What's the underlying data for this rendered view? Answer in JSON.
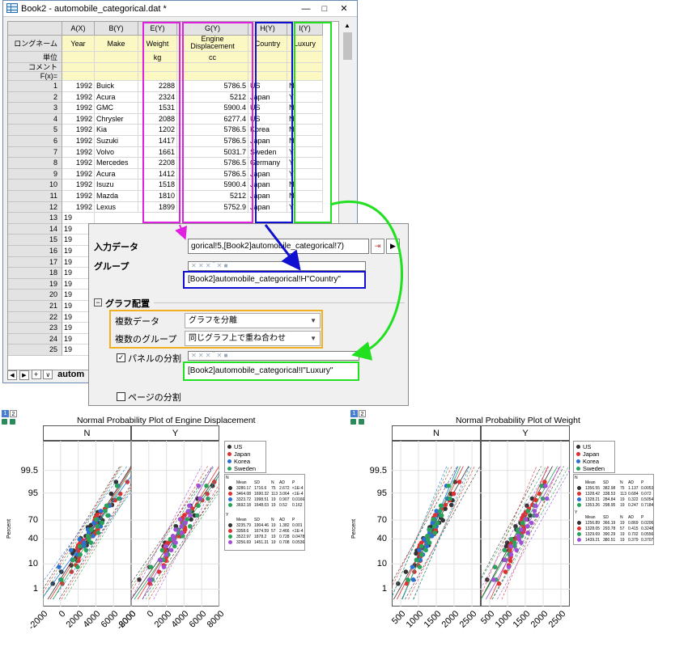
{
  "window": {
    "title": "Book2 - automobile_categorical.dat *",
    "min": "—",
    "max": "□",
    "close": "✕"
  },
  "sheet": {
    "columns": [
      {
        "header": "A(X)",
        "long": "Year",
        "unit": "",
        "w": 40
      },
      {
        "header": "B(Y)",
        "long": "Make",
        "unit": "",
        "w": 54
      },
      {
        "header": "E(Y)",
        "long": "Weight",
        "unit": "kg",
        "w": 48
      },
      {
        "header": "G(Y)",
        "long": "Engine Displacement",
        "unit": "cc",
        "w": 88
      },
      {
        "header": "H(Y)",
        "long": "Country",
        "unit": "",
        "w": 48
      },
      {
        "header": "I(Y)",
        "long": "Luxury",
        "unit": "",
        "w": 44
      }
    ],
    "meta_rows": [
      "ロングネーム",
      "単位",
      "コメント",
      "F(x)="
    ],
    "rows": [
      [
        "1992",
        "Buick",
        "2288",
        "5786.5",
        "US",
        "N"
      ],
      [
        "1992",
        "Acura",
        "2324",
        "5212",
        "Japan",
        "Y"
      ],
      [
        "1992",
        "GMC",
        "1531",
        "5900.4",
        "US",
        "N"
      ],
      [
        "1992",
        "Chrysler",
        "2088",
        "6277.4",
        "US",
        "N"
      ],
      [
        "1992",
        "Kia",
        "1202",
        "5786.5",
        "Korea",
        "N"
      ],
      [
        "1992",
        "Suzuki",
        "1417",
        "5786.5",
        "Japan",
        "N"
      ],
      [
        "1992",
        "Volvo",
        "1661",
        "5031.7",
        "Sweden",
        "Y"
      ],
      [
        "1992",
        "Mercedes",
        "2208",
        "5786.5",
        "Germany",
        "Y"
      ],
      [
        "1992",
        "Acura",
        "1412",
        "5786.5",
        "Japan",
        "Y"
      ],
      [
        "1992",
        "Isuzu",
        "1518",
        "5900.4",
        "Japan",
        "N"
      ],
      [
        "1992",
        "Mazda",
        "1810",
        "5212",
        "Japan",
        "N"
      ],
      [
        "1992",
        "Lexus",
        "1899",
        "5752.9",
        "Japan",
        "Y"
      ]
    ],
    "extra_row_nums": [
      "13",
      "14",
      "15",
      "16",
      "17",
      "18",
      "19",
      "20",
      "21",
      "22",
      "23",
      "24",
      "25"
    ],
    "extra_year_partial": "19",
    "tab_name": "autom"
  },
  "dialog": {
    "input_label": "入力データ",
    "input_value": "gorical!5,[Book2]automobile_categorical!7)",
    "group_label": "グループ",
    "group_value": "[Book2]automobile_categorical!H\"Country\"",
    "section_label": "グラフ配置",
    "multi_data_label": "複数データ",
    "multi_data_value": "グラフを分離",
    "multi_group_label": "複数のグループ",
    "multi_group_value": "同じグラフ上で重ね合わせ",
    "panel_split_label": "パネルの分割",
    "panel_split_value": "[Book2]automobile_categorical!I\"Luxury\"",
    "page_split_label": "ページの分割"
  },
  "plots": [
    {
      "title": "Normal Probability Plot of Engine Displacement",
      "panels": [
        "N",
        "Y"
      ],
      "yticks": [
        "99.5",
        "95",
        "70",
        "40",
        "10",
        "1"
      ],
      "ylabel": "Percent",
      "xticks": [
        "-2000",
        "0",
        "2000",
        "4000",
        "6000",
        "8000"
      ],
      "legend": [
        "US",
        "Japan",
        "Korea",
        "Sweden"
      ],
      "stats_header": [
        "Mean",
        "SD",
        "N",
        "AD",
        "P"
      ],
      "stats_N": [
        [
          "3280.17",
          "1716.6",
          "75",
          "2.672",
          "<1E-4"
        ],
        [
          "3464.08",
          "1690.32",
          "113",
          "3.064",
          "<1E-4"
        ],
        [
          "3323.72",
          "1998.51",
          "19",
          "0.907",
          "0.0166"
        ],
        [
          "3692.18",
          "1648.03",
          "19",
          "0.52",
          "0.162"
        ]
      ],
      "stats_Y": [
        [
          "3235.79",
          "1904.46",
          "19",
          "1.382",
          "0.001"
        ],
        [
          "3358.6",
          "1674.59",
          "57",
          "2.466",
          "<1E-4"
        ],
        [
          "3522.97",
          "1878.2",
          "19",
          "0.728",
          "0.0478"
        ],
        [
          "3256.69",
          "1451.31",
          "19",
          "0.708",
          "0.0536"
        ]
      ]
    },
    {
      "title": "Normal Probability Plot of Weight",
      "panels": [
        "N",
        "Y"
      ],
      "yticks": [
        "99.5",
        "95",
        "70",
        "40",
        "10",
        "1"
      ],
      "ylabel": "Percent",
      "xticks": [
        "500",
        "1000",
        "1500",
        "2000",
        "2500"
      ],
      "legend": [
        "US",
        "Japan",
        "Korea",
        "Sweden"
      ],
      "stats_header": [
        "Mean",
        "SD",
        "N",
        "AD",
        "P"
      ],
      "stats_N": [
        [
          "1356.55",
          "382.98",
          "75",
          "1.137",
          "0.0053"
        ],
        [
          "1328.42",
          "338.53",
          "113",
          "0.684",
          "0.072"
        ],
        [
          "1328.21",
          "284.84",
          "19",
          "0.322",
          "0.5054"
        ],
        [
          "1353.26",
          "298.95",
          "19",
          "0.247",
          "0.7184"
        ]
      ],
      "stats_Y": [
        [
          "1256.89",
          "366.19",
          "19",
          "0.869",
          "0.0206"
        ],
        [
          "1328.05",
          "293.78",
          "57",
          "0.415",
          "0.3248"
        ],
        [
          "1329.69",
          "390.29",
          "19",
          "0.702",
          "0.0556"
        ],
        [
          "1439.21",
          "380.51",
          "19",
          "0.379",
          "0.3707"
        ]
      ]
    }
  ],
  "colors": {
    "us": "#333333",
    "japan": "#e03030",
    "korea": "#2a6fd6",
    "sweden": "#2aa35a",
    "purple": "#a050d8",
    "magenta": "#e020e0",
    "blue": "#1010d0",
    "green": "#20e020",
    "orange": "#f0b020"
  },
  "page_tabs": [
    "1",
    "2"
  ]
}
